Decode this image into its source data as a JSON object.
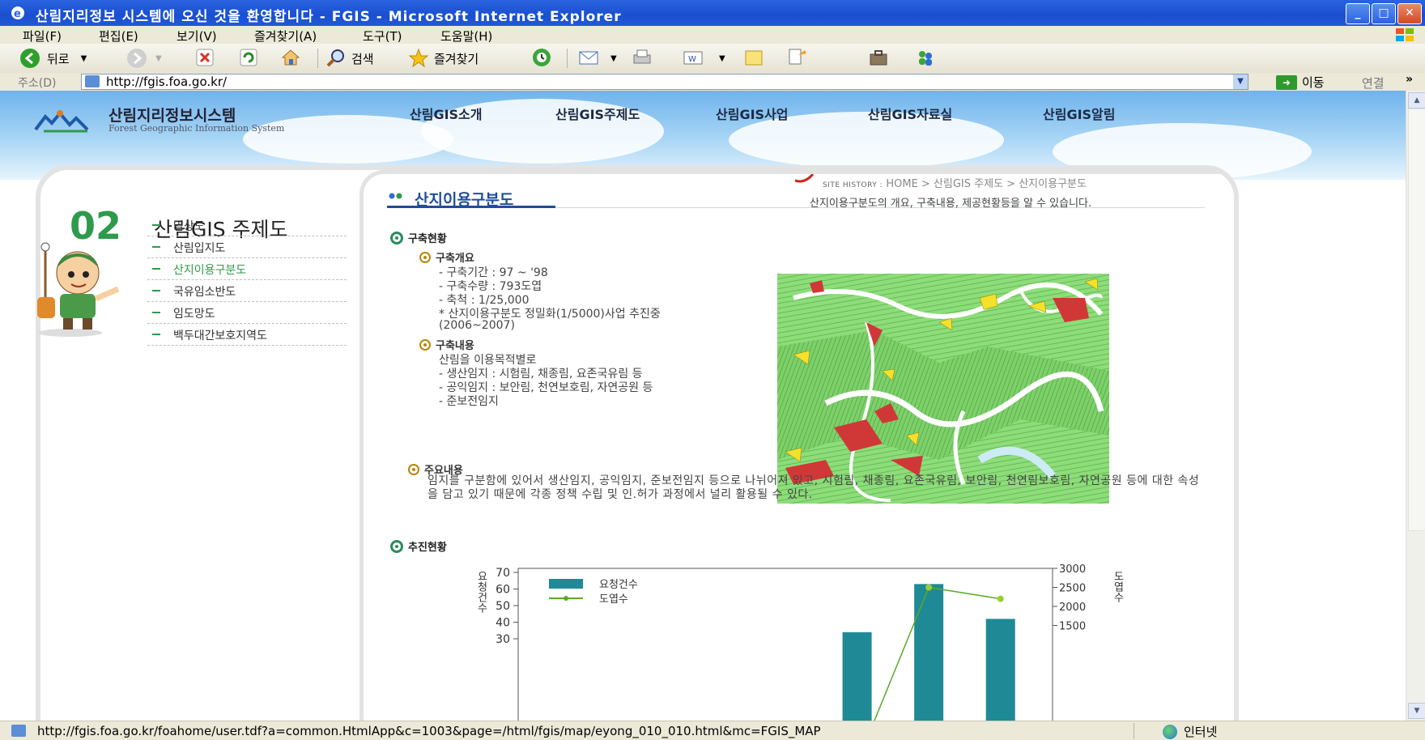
{
  "window": {
    "title": "산림지리정보 시스템에 오신 것을 환영합니다 - FGIS - Microsoft Internet Explorer",
    "min": "_",
    "max": "□",
    "close": "✕"
  },
  "menu": [
    "파일(F)",
    "편집(E)",
    "보기(V)",
    "즐겨찾기(A)",
    "도구(T)",
    "도움말(H)"
  ],
  "toolbar": {
    "back": "뒤로",
    "search": "검색",
    "favorites": "즐겨찾기"
  },
  "address": {
    "label": "주소(D)",
    "url": "http://fgis.foa.go.kr/",
    "go": "이동",
    "links": "연결",
    "more": "»"
  },
  "site": {
    "title": "산림지리정보시스템",
    "subtitle": "Forest Geographic Information System",
    "nav": [
      "산림GIS소개",
      "산림GIS주제도",
      "산림GIS사업",
      "산림GIS자료실",
      "산림GIS알림"
    ]
  },
  "breadcrumb": {
    "prefix": "SITE HISTORY :",
    "path": "HOME > 산림GIS 주제도 > 산지이용구분도"
  },
  "section": {
    "number": "02",
    "title": "산림GIS 주제도",
    "menu": [
      {
        "label": "임상도",
        "active": false
      },
      {
        "label": "산림입지도",
        "active": false
      },
      {
        "label": "산지이용구분도",
        "active": true
      },
      {
        "label": "국유임소반도",
        "active": false
      },
      {
        "label": "임도망도",
        "active": false
      },
      {
        "label": "백두대간보호지역도",
        "active": false
      }
    ]
  },
  "content": {
    "heading": "산지이용구분도",
    "description": "산지이용구분도의 개요, 구축내용, 제공현황등을 알 수 있습니다.",
    "build_status": "구축현황",
    "overview_title": "구축개요",
    "overview_lines": [
      "- 구축기간 : 97 ~ '98",
      "- 구축수량 : 793도엽",
      "- 축척 : 1/25,000",
      "* 산지이용구분도 정밀화(1/5000)사업 추진중",
      "(2006~2007)"
    ],
    "content_title": "구축내용",
    "content_lines": [
      "산림을 이용목적별로",
      "- 생산임지 : 시험림, 채종림, 요존국유림 등",
      "- 공익임지 : 보안림, 천연보호림, 자연공원 등",
      "- 준보전임지"
    ],
    "main_title": "주요내용",
    "main_text": "임지를 구분함에 있어서 생산임지, 공익임지, 준보전임지 등으로 나뉘어져 있고, 시험림, 채종림, 요존국유림, 보안림, 천연림보호림, 자연공원 등에 대한 속성을 담고 있기 때문에 각종 정책 수립 및 인.허가 과정에서 널리 활용될 수 있다.",
    "progress_title": "추진현황"
  },
  "chart_data": {
    "type": "bar",
    "categories": [
      "",
      "",
      "",
      "",
      "",
      "",
      ""
    ],
    "series": [
      {
        "name": "요청건수",
        "type": "bar",
        "values": [
          null,
          null,
          null,
          null,
          34,
          63,
          42
        ]
      },
      {
        "name": "도엽수",
        "type": "line",
        "values": [
          null,
          null,
          null,
          null,
          null,
          2500,
          2200
        ]
      }
    ],
    "ylabel_left": "요청건수",
    "ylabel_right": "도엽수",
    "yticks_left": [
      "30",
      "40",
      "50",
      "60",
      "70"
    ],
    "yticks_right": [
      "1500",
      "2000",
      "2500",
      "3000"
    ],
    "ylim_left": [
      25,
      70
    ],
    "ylim_right": [
      1000,
      3000
    ],
    "legend": "top-left",
    "bar_color": "#1f8a96",
    "line_color": "#5aaa2a"
  },
  "status": {
    "url": "http://fgis.foa.go.kr/foahome/user.tdf?a=common.HtmlApp&c=1003&page=/html/fgis/map/eyong_010_010.html&mc=FGIS_MAP",
    "zone": "인터넷"
  }
}
